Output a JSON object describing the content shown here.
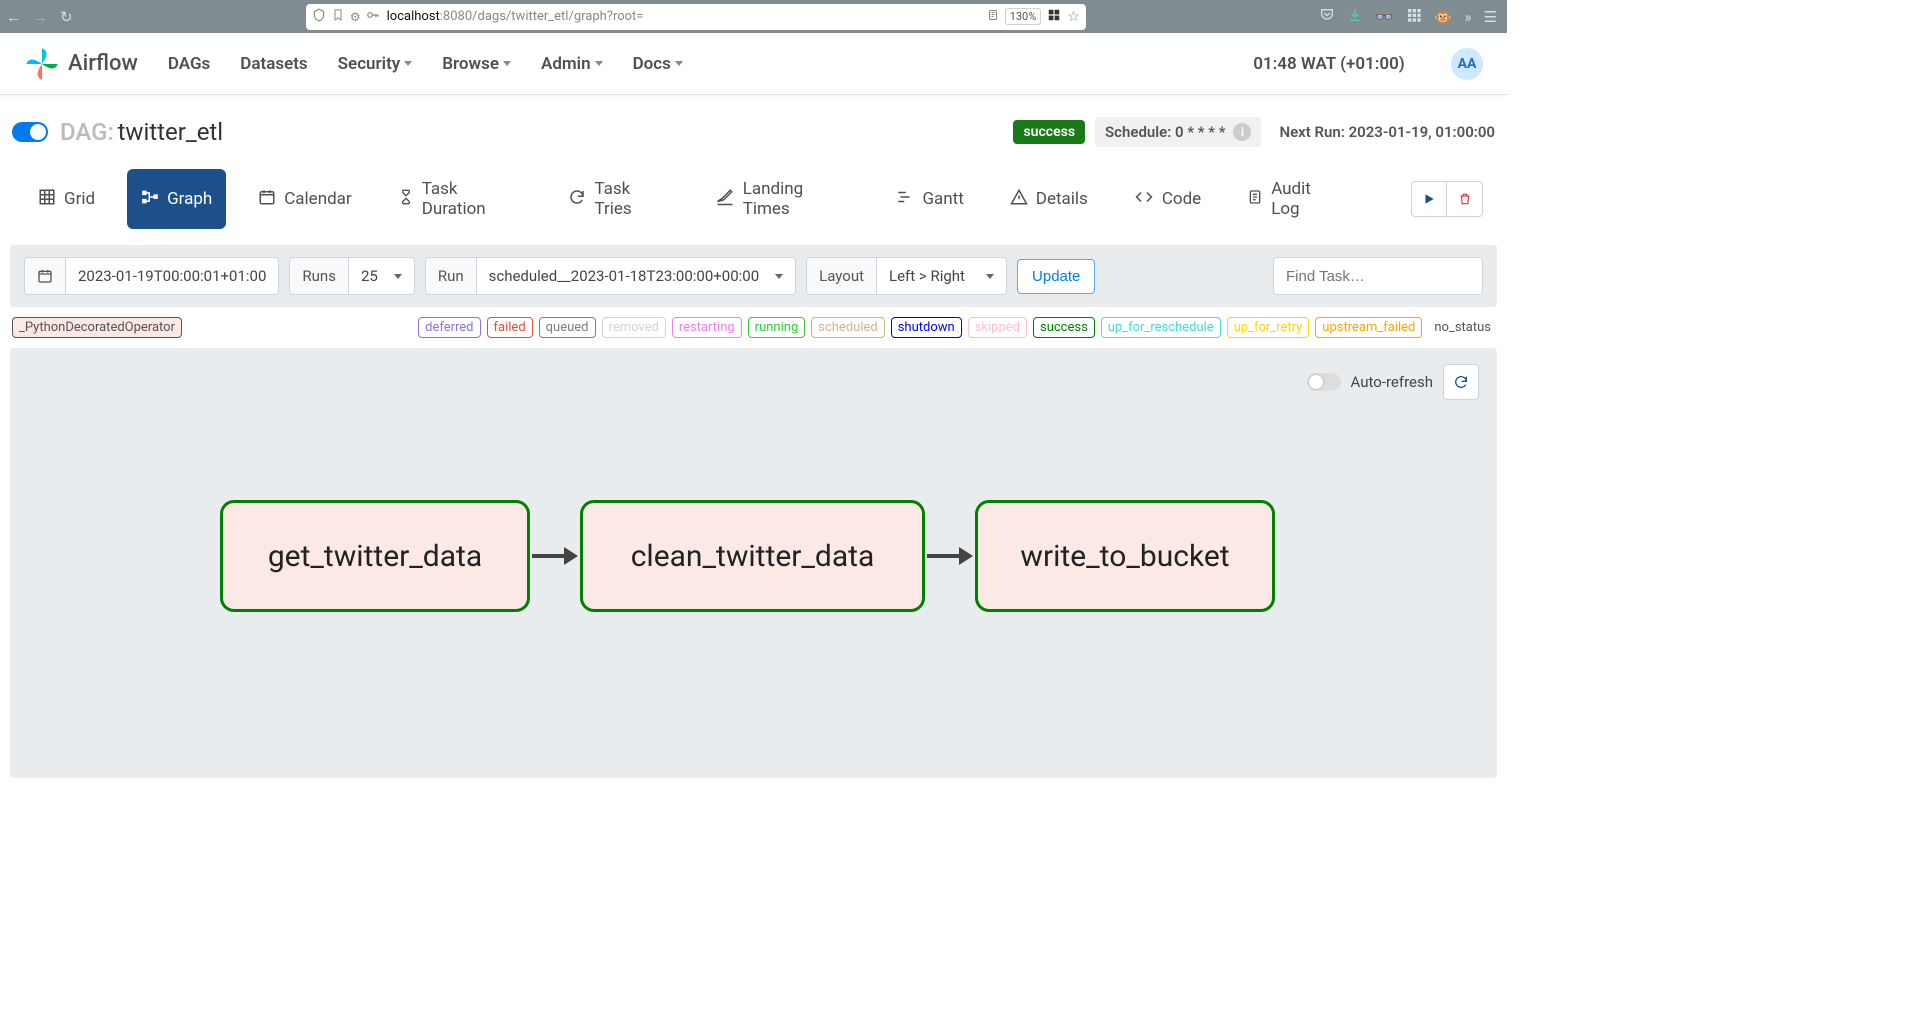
{
  "browser": {
    "url_protocol_host": "localhost",
    "url_rest": ":8080/dags/twitter_etl/graph?root=",
    "zoom": "130%"
  },
  "navbar": {
    "brand": "Airflow",
    "items": [
      "DAGs",
      "Datasets",
      "Security",
      "Browse",
      "Admin",
      "Docs"
    ],
    "dropdown_flags": [
      false,
      false,
      true,
      true,
      true,
      true
    ],
    "clock": "01:48 WAT (+01:00)",
    "user_initials": "AA"
  },
  "dag": {
    "label_prefix": "DAG:",
    "name": "twitter_etl",
    "status": "success",
    "schedule_label": "Schedule: 0 * * * *",
    "next_run_label": "Next Run: 2023-01-19, 01:00:00"
  },
  "tabs": {
    "items": [
      "Grid",
      "Graph",
      "Calendar",
      "Task Duration",
      "Task Tries",
      "Landing Times",
      "Gantt",
      "Details",
      "Code",
      "Audit Log"
    ],
    "active_index": 1
  },
  "filters": {
    "base_date": "2023-01-19T00:00:01+01:00",
    "runs_label": "Runs",
    "runs_value": "25",
    "run_label": "Run",
    "run_value": "scheduled__2023-01-18T23:00:00+00:00",
    "layout_label": "Layout",
    "layout_value": "Left > Right",
    "update_label": "Update",
    "find_placeholder": "Find Task…"
  },
  "legend": {
    "operator": "_PythonDecoratedOperator",
    "states": [
      {
        "label": "deferred",
        "color": "#9370db"
      },
      {
        "label": "failed",
        "color": "#e74c3c"
      },
      {
        "label": "queued",
        "color": "#808080"
      },
      {
        "label": "removed",
        "color": "#d3d3d3"
      },
      {
        "label": "restarting",
        "color": "#ee82ee"
      },
      {
        "label": "running",
        "color": "#32cd32"
      },
      {
        "label": "scheduled",
        "color": "#d2b48c"
      },
      {
        "label": "shutdown",
        "color": "#0000ff"
      },
      {
        "label": "skipped",
        "color": "#ffc0cb"
      },
      {
        "label": "success",
        "color": "#008000"
      },
      {
        "label": "up_for_reschedule",
        "color": "#40e0d0"
      },
      {
        "label": "up_for_retry",
        "color": "#ffd700"
      },
      {
        "label": "upstream_failed",
        "color": "#ffa500"
      }
    ],
    "no_status": "no_status"
  },
  "canvas": {
    "auto_refresh_label": "Auto-refresh",
    "nodes": [
      "get_twitter_data",
      "clean_twitter_data",
      "write_to_bucket"
    ]
  }
}
